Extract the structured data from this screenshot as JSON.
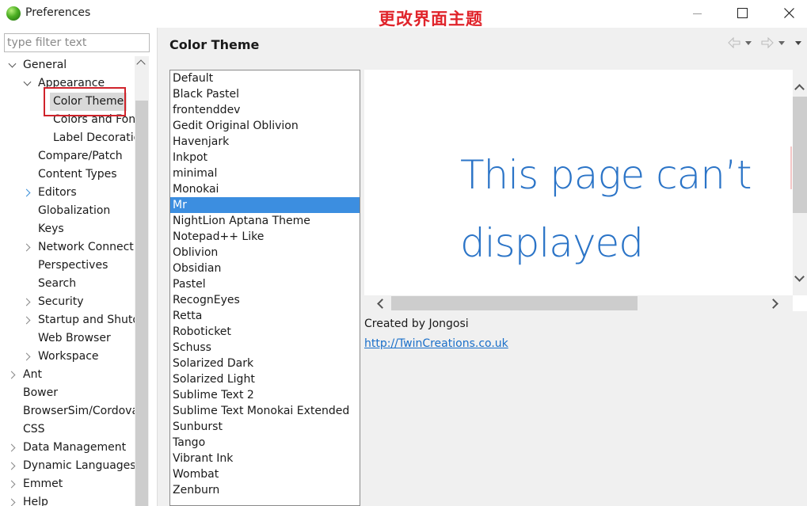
{
  "window": {
    "title": "Preferences",
    "annotation": "更改界面主题",
    "controls": {
      "minimize": "minimize",
      "maximize": "maximize",
      "close": "close"
    }
  },
  "filter": {
    "placeholder": "type filter text",
    "value": ""
  },
  "tree": [
    {
      "label": "General",
      "depth": 0,
      "twisty": "expanded"
    },
    {
      "label": "Appearance",
      "depth": 1,
      "twisty": "expanded"
    },
    {
      "label": "Color Theme",
      "depth": 2,
      "twisty": "none",
      "selected": true
    },
    {
      "label": "Colors and Fonts",
      "depth": 2,
      "twisty": "none"
    },
    {
      "label": "Label Decorations",
      "depth": 2,
      "twisty": "none"
    },
    {
      "label": "Compare/Patch",
      "depth": 1,
      "twisty": "none"
    },
    {
      "label": "Content Types",
      "depth": 1,
      "twisty": "none"
    },
    {
      "label": "Editors",
      "depth": 1,
      "twisty": "collapsed",
      "accent": true
    },
    {
      "label": "Globalization",
      "depth": 1,
      "twisty": "none"
    },
    {
      "label": "Keys",
      "depth": 1,
      "twisty": "none"
    },
    {
      "label": "Network Connections",
      "depth": 1,
      "twisty": "collapsed"
    },
    {
      "label": "Perspectives",
      "depth": 1,
      "twisty": "none"
    },
    {
      "label": "Search",
      "depth": 1,
      "twisty": "none"
    },
    {
      "label": "Security",
      "depth": 1,
      "twisty": "collapsed"
    },
    {
      "label": "Startup and Shutdown",
      "depth": 1,
      "twisty": "collapsed"
    },
    {
      "label": "Web Browser",
      "depth": 1,
      "twisty": "none"
    },
    {
      "label": "Workspace",
      "depth": 1,
      "twisty": "collapsed"
    },
    {
      "label": "Ant",
      "depth": 0,
      "twisty": "collapsed"
    },
    {
      "label": "Bower",
      "depth": 0,
      "twisty": "none"
    },
    {
      "label": "BrowserSim/CordovaSim",
      "depth": 0,
      "twisty": "none"
    },
    {
      "label": "CSS",
      "depth": 0,
      "twisty": "none"
    },
    {
      "label": "Data Management",
      "depth": 0,
      "twisty": "collapsed"
    },
    {
      "label": "Dynamic Languages",
      "depth": 0,
      "twisty": "collapsed"
    },
    {
      "label": "Emmet",
      "depth": 0,
      "twisty": "collapsed"
    },
    {
      "label": "Help",
      "depth": 0,
      "twisty": "collapsed"
    }
  ],
  "page": {
    "title": "Color Theme",
    "themes": [
      "Default",
      "Black Pastel",
      "frontenddev",
      "Gedit Original Oblivion",
      "Havenjark",
      "Inkpot",
      "minimal",
      "Monokai",
      "Mr",
      "NightLion Aptana Theme",
      "Notepad++ Like",
      "Oblivion",
      "Obsidian",
      "Pastel",
      "RecognEyes",
      "Retta",
      "Roboticket",
      "Schuss",
      "Solarized Dark",
      "Solarized Light",
      "Sublime Text 2",
      "Sublime Text Monokai Extended",
      "Sunburst",
      "Tango",
      "Vibrant Ink",
      "Wombat",
      "Zenburn"
    ],
    "selected_theme": "Mr",
    "preview": {
      "line1": "This page can’t",
      "line2": "displayed"
    },
    "author": "Created by Jongosi",
    "link": "http://TwinCreations.co.uk"
  },
  "colors": {
    "selection": "#3c8ee0",
    "annotation": "#e0242b",
    "link": "#1a6fc9",
    "preview_text": "#2b74c7"
  }
}
